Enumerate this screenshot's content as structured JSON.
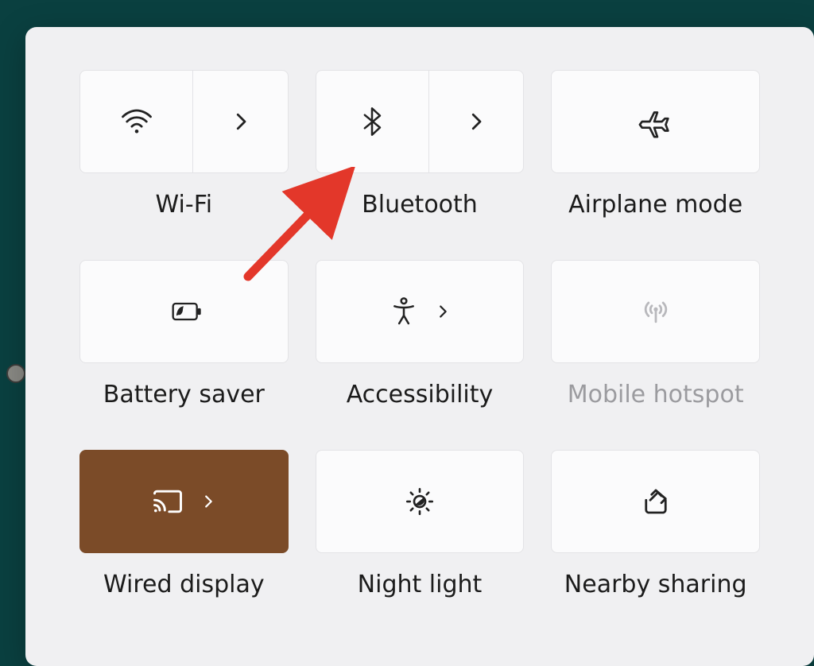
{
  "tiles": [
    {
      "id": "wifi",
      "label": "Wi-Fi",
      "split": true,
      "active": false,
      "disabled": false
    },
    {
      "id": "bluetooth",
      "label": "Bluetooth",
      "split": true,
      "active": false,
      "disabled": false
    },
    {
      "id": "airplane",
      "label": "Airplane mode",
      "split": false,
      "inline_chevron": false,
      "active": false,
      "disabled": false
    },
    {
      "id": "battery",
      "label": "Battery saver",
      "split": false,
      "inline_chevron": false,
      "active": false,
      "disabled": false
    },
    {
      "id": "accessibility",
      "label": "Accessibility",
      "split": false,
      "inline_chevron": true,
      "active": false,
      "disabled": false
    },
    {
      "id": "hotspot",
      "label": "Mobile hotspot",
      "split": false,
      "inline_chevron": false,
      "active": false,
      "disabled": true
    },
    {
      "id": "cast",
      "label": "Wired display",
      "split": false,
      "inline_chevron": true,
      "active": true,
      "disabled": false
    },
    {
      "id": "nightlight",
      "label": "Night light",
      "split": false,
      "inline_chevron": false,
      "active": false,
      "disabled": false
    },
    {
      "id": "nearby",
      "label": "Nearby sharing",
      "split": false,
      "inline_chevron": false,
      "active": false,
      "disabled": false
    }
  ],
  "annotation": {
    "type": "arrow",
    "target": "bluetooth"
  }
}
